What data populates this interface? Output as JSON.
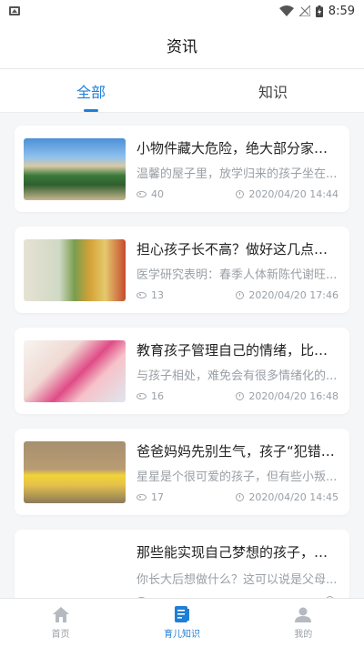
{
  "status_bar": {
    "time": "8:59"
  },
  "header": {
    "title": "资讯"
  },
  "tabs": [
    {
      "label": "全部",
      "active": true
    },
    {
      "label": "知识",
      "active": false
    }
  ],
  "articles": [
    {
      "title": "小物件藏大危险，绝大部分家长...",
      "desc": "温馨的屋子里，放学归来的孩子坐在...",
      "views": "40",
      "date": "2020/04/20 14:44"
    },
    {
      "title": "担心孩子长不高？做好这几点，...",
      "desc": "医学研究表明：春季人体新陈代谢旺...",
      "views": "13",
      "date": "2020/04/20 17:46"
    },
    {
      "title": "教育孩子管理自己的情绪，比直...",
      "desc": "与孩子相处，难免会有很多情绪化的...",
      "views": "16",
      "date": "2020/04/20 16:48"
    },
    {
      "title": "爸爸妈妈先别生气，孩子“犯错”...",
      "desc": "星星是个很可爱的孩子，但有些小叛...",
      "views": "17",
      "date": "2020/04/20 14:45"
    },
    {
      "title": "那些能实现自己梦想的孩子，背...",
      "desc": "你长大后想做什么？这可以说是父母...",
      "views": "",
      "date": ""
    }
  ],
  "bottom_nav": [
    {
      "label": "首页",
      "icon": "home-icon",
      "active": false
    },
    {
      "label": "育儿知识",
      "icon": "document-icon",
      "active": true
    },
    {
      "label": "我的",
      "icon": "user-icon",
      "active": false
    }
  ],
  "colors": {
    "accent": "#1f7fd6",
    "muted": "#9aa0a6"
  }
}
